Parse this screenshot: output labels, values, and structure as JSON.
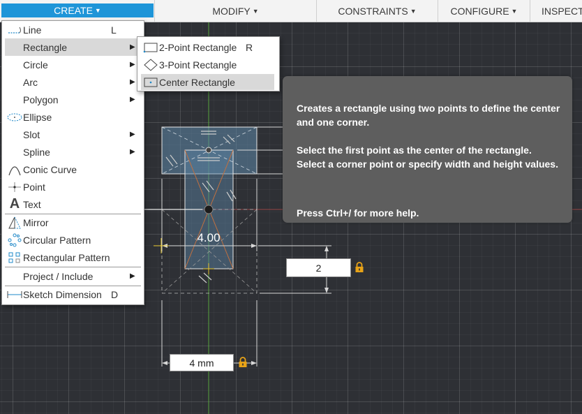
{
  "toolbar": {
    "create": "CREATE",
    "modify": "MODIFY",
    "constraints": "CONSTRAINTS",
    "configure": "CONFIGURE",
    "inspect": "INSPECT"
  },
  "create_menu": {
    "line": {
      "label": "Line",
      "shortcut": "L"
    },
    "rectangle": {
      "label": "Rectangle"
    },
    "circle": {
      "label": "Circle"
    },
    "arc": {
      "label": "Arc"
    },
    "polygon": {
      "label": "Polygon"
    },
    "ellipse": {
      "label": "Ellipse"
    },
    "slot": {
      "label": "Slot"
    },
    "spline": {
      "label": "Spline"
    },
    "conic_curve": {
      "label": "Conic Curve"
    },
    "point": {
      "label": "Point"
    },
    "text": {
      "label": "Text"
    },
    "mirror": {
      "label": "Mirror"
    },
    "circular_pattern": {
      "label": "Circular Pattern"
    },
    "rectangular_pattern": {
      "label": "Rectangular Pattern"
    },
    "project_include": {
      "label": "Project / Include"
    },
    "sketch_dimension": {
      "label": "Sketch Dimension",
      "shortcut": "D"
    }
  },
  "rectangle_submenu": {
    "two_point": {
      "label": "2-Point Rectangle",
      "shortcut": "R"
    },
    "three_point": {
      "label": "3-Point Rectangle"
    },
    "center": {
      "label": "Center Rectangle"
    }
  },
  "tooltip": {
    "line1": "Creates a rectangle using two points to define the center and one corner.",
    "line2": "Select the first point as the center of the rectangle. Select a corner point or specify width and height values.",
    "line3": "Press Ctrl+/ for more help."
  },
  "sketch": {
    "dimension_label": "4.00",
    "height_value": "2",
    "width_value": "4 mm"
  },
  "colors": {
    "accent": "#1e95d8",
    "lock": "#e8a317",
    "sketch_fill": "#5e88a8",
    "axis_green": "#5fbf3f",
    "axis_red": "#b04a4a"
  }
}
